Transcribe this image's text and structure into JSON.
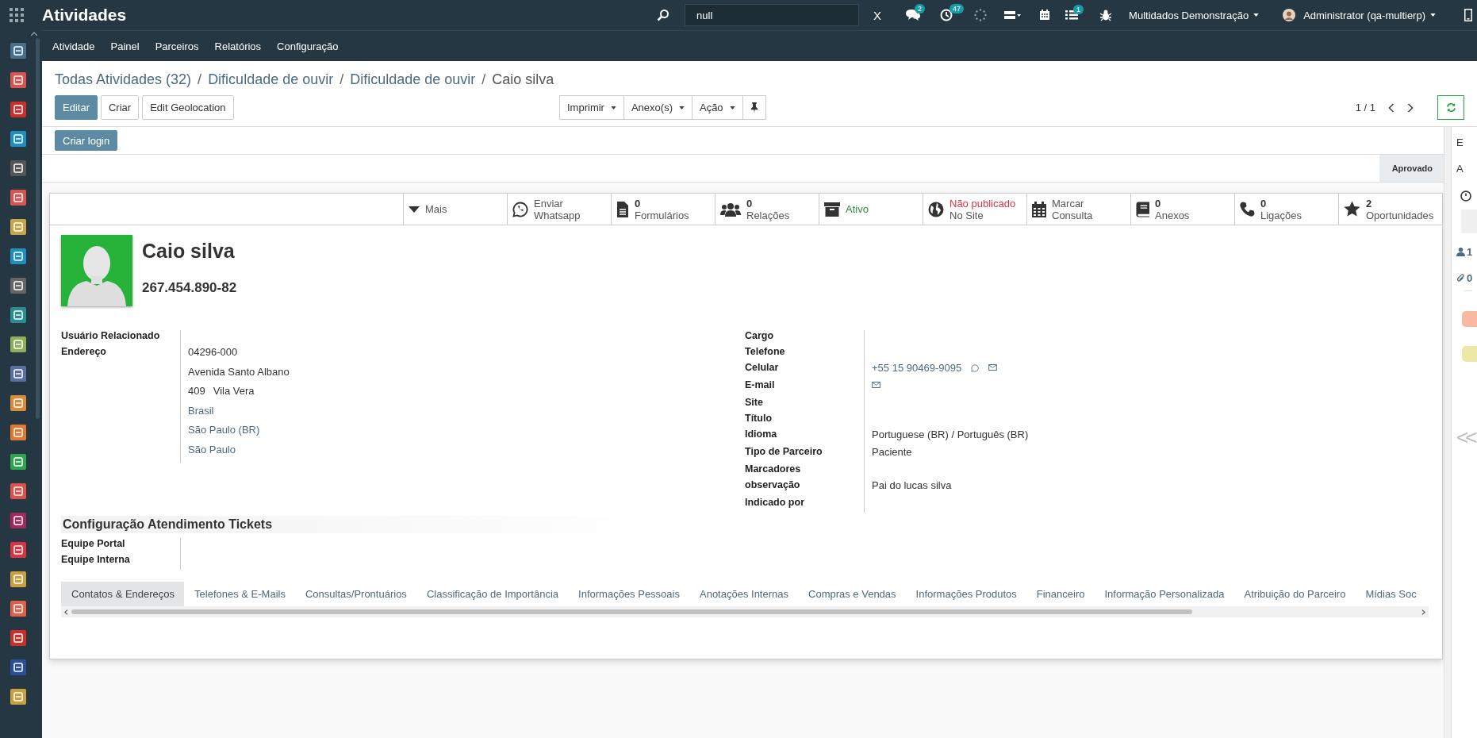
{
  "topbar": {
    "app_title": "Atividades",
    "search": {
      "value": "null"
    },
    "clear_label": "X",
    "messages_badge": "2",
    "activities_badge": "47",
    "tasks_badge": "1",
    "company": "Multidados Demonstração",
    "user": "Administrator (qa-multierp)"
  },
  "menu": [
    "Atividade",
    "Painel",
    "Parceiros",
    "Relatórios",
    "Configuração"
  ],
  "breadcrumbs": [
    {
      "label": "Todas Atividades (32)",
      "current": false
    },
    {
      "separator": "/",
      "label": "Dificuldade de ouvir",
      "current": false
    },
    {
      "separator": "/",
      "label": "Dificuldade de ouvir",
      "current": false
    },
    {
      "separator": "/",
      "label": "Caio silva",
      "current": true
    }
  ],
  "actions": [
    {
      "label": "Editar",
      "kind": "primary"
    },
    {
      "label": "Criar",
      "kind": "default"
    },
    {
      "label": "Edit Geolocation",
      "kind": "default"
    }
  ],
  "dropdowns": [
    "Imprimir",
    "Anexo(s)",
    "Ação"
  ],
  "pager": "1 / 1",
  "header_buttons": [
    "Criar login"
  ],
  "statusbar": [
    {
      "label": "Aprovado",
      "selected": true
    }
  ],
  "smart_buttons": [
    {
      "kind": "menu",
      "label": "Mais"
    },
    {
      "kind": "text",
      "lines": [
        "Enviar",
        "Whatsapp"
      ]
    },
    {
      "kind": "count",
      "value": "0",
      "label": "Formulários"
    },
    {
      "kind": "count",
      "value": "0",
      "label": "Relações"
    },
    {
      "kind": "status",
      "lines": [
        "Ativo"
      ],
      "color": "#2e8b3e"
    },
    {
      "kind": "status",
      "lines": [
        "Não publicado",
        "No Site"
      ],
      "color": "#d9343f"
    },
    {
      "kind": "text",
      "lines": [
        "Marcar",
        "Consulta"
      ]
    },
    {
      "kind": "count",
      "value": "0",
      "label": "Anexos"
    },
    {
      "kind": "count",
      "value": "0",
      "label": "Ligações"
    },
    {
      "kind": "count",
      "value": "2",
      "label": "Oportunidades"
    }
  ],
  "partner": {
    "name": "Caio silva",
    "cpf": "267.454.890-82"
  },
  "left_fields": [
    {
      "label": "Usuário Relacionado"
    },
    {
      "label": "Endereço",
      "lines": [
        {
          "parts": [
            "04296-000"
          ],
          "link": false
        },
        {
          "parts": [
            "Avenida Santo Albano"
          ],
          "link": false
        },
        {
          "parts": [
            "409",
            "Vila Vera"
          ],
          "link": false
        },
        {
          "parts": [
            "Brasil"
          ],
          "link": true
        },
        {
          "parts": [
            "São Paulo (BR)"
          ],
          "link": true
        },
        {
          "parts": [
            "São Paulo"
          ],
          "link": true
        }
      ]
    }
  ],
  "right_fields": [
    {
      "label": "Cargo"
    },
    {
      "label": "Telefone"
    },
    {
      "label": "Celular",
      "value": "+55 15 90469-9095",
      "link": true,
      "whatsapp": true,
      "mail": true
    },
    {
      "label": "E-mail",
      "mail": true
    },
    {
      "label": "Site"
    },
    {
      "label": "Título"
    },
    {
      "label": "Idioma",
      "value": "Portuguese (BR) / Português (BR)"
    },
    {
      "label": "Tipo de Parceiro",
      "value": "Paciente"
    },
    {
      "label": "Marcadores"
    },
    {
      "label": "observação",
      "value": "Pai do lucas silva"
    },
    {
      "label": "Indicado por"
    }
  ],
  "ticket_section": {
    "title": "Configuração Atendimento Tickets",
    "fields": [
      {
        "label": "Equipe Portal"
      },
      {
        "label": "Equipe Interna"
      }
    ]
  },
  "tabs": [
    {
      "label": "Contatos & Endereços",
      "selected": true
    },
    {
      "label": "Telefones & E-Mails",
      "selected": false
    },
    {
      "label": "Consultas/Prontuários",
      "selected": false
    },
    {
      "label": "Classificação de Importância",
      "selected": false
    },
    {
      "label": "Informações Pessoais",
      "selected": false
    },
    {
      "label": "Anotações Internas",
      "selected": false
    },
    {
      "label": "Compras e Vendas",
      "selected": false
    },
    {
      "label": "Informações Produtos",
      "selected": false
    },
    {
      "label": "Financeiro",
      "selected": false
    },
    {
      "label": "Informação Personalizada",
      "selected": false
    },
    {
      "label": "Atribuição do Parceiro",
      "selected": false
    },
    {
      "label": "Mídias Soc",
      "selected": false
    }
  ],
  "chatter": {
    "lines": [
      "E",
      "A"
    ],
    "followers": "1",
    "attachments": "0",
    "tags": [
      {
        "color": "#f8b8a2"
      },
      {
        "color": "#ece9a8"
      }
    ],
    "collapse_label": "<<"
  }
}
